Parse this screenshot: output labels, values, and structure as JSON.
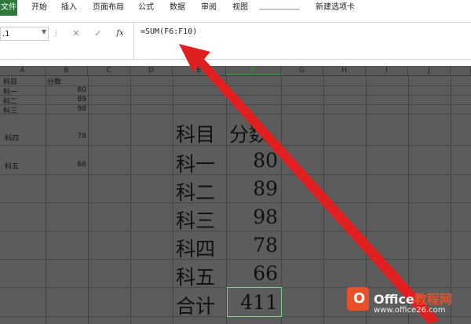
{
  "ribbon": {
    "file_tab": "文件",
    "tabs": [
      "开始",
      "插入",
      "页面布局",
      "公式",
      "数据",
      "审阅",
      "视图",
      "新建选项卡"
    ],
    "accent_color": "#2e7a3e"
  },
  "formula_bar": {
    "name_box": ".1",
    "cancel_icon": "close-icon",
    "confirm_icon": "check-icon",
    "fx_label": "fx",
    "formula": "=SUM(F6:F10)"
  },
  "columns": [
    "A",
    "B",
    "C",
    "D",
    "E",
    "F",
    "G",
    "H",
    "I",
    "J"
  ],
  "selected_column": "F",
  "small_table": {
    "header": [
      "科目",
      "分数"
    ],
    "rows": [
      {
        "subject": "科一",
        "score": "80"
      },
      {
        "subject": "科二",
        "score": "89"
      },
      {
        "subject": "科三",
        "score": "98"
      },
      {
        "subject": "科四",
        "score": "78"
      },
      {
        "subject": "科五",
        "score": "66"
      }
    ]
  },
  "big_table": {
    "header": [
      "科目",
      "分数"
    ],
    "rows": [
      {
        "subject": "科一",
        "score": "80"
      },
      {
        "subject": "科二",
        "score": "89"
      },
      {
        "subject": "科三",
        "score": "98"
      },
      {
        "subject": "科四",
        "score": "78"
      },
      {
        "subject": "科五",
        "score": "66"
      }
    ],
    "total_label": "合计",
    "total_value": "411"
  },
  "annotation": {
    "arrow_color": "#e02020"
  },
  "watermark": {
    "logo_letter": "O",
    "title_main": "Office",
    "title_accent": "教程网",
    "url": "www.office26.com"
  }
}
